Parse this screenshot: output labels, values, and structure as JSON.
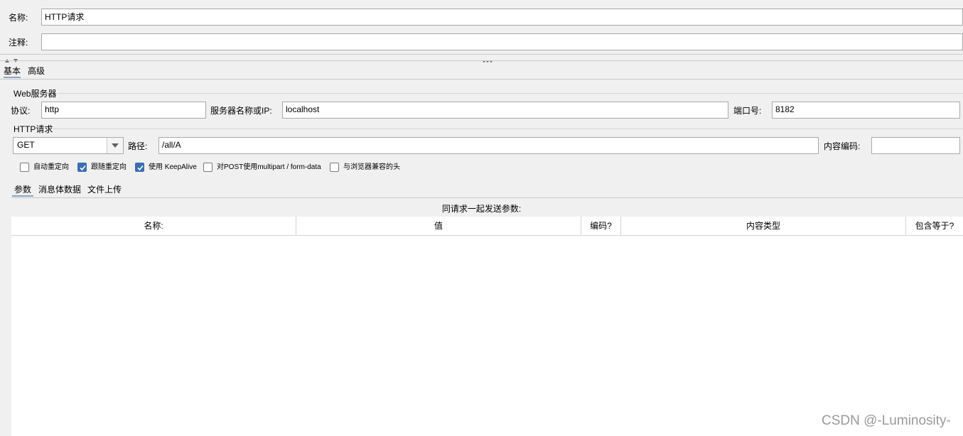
{
  "name_row": {
    "label": "名称:",
    "value": "HTTP请求"
  },
  "comment_row": {
    "label": "注释:",
    "value": ""
  },
  "tabs": [
    {
      "label": "基本",
      "active": true
    },
    {
      "label": "高级",
      "active": false
    }
  ],
  "web_server": {
    "title": "Web服务器",
    "protocol_label": "协议:",
    "protocol_value": "http",
    "server_label": "服务器名称或IP:",
    "server_value": "localhost",
    "port_label": "端口号:",
    "port_value": "8182"
  },
  "http_request": {
    "title": "HTTP请求",
    "method": "GET",
    "path_label": "路径:",
    "path_value": "/all/A",
    "encoding_label": "内容编码:",
    "encoding_value": ""
  },
  "checkboxes": [
    {
      "label": "自动重定向",
      "checked": false
    },
    {
      "label": "跟随重定向",
      "checked": true
    },
    {
      "label": "使用 KeepAlive",
      "checked": true
    },
    {
      "label": "对POST使用multipart / form-data",
      "checked": false
    },
    {
      "label": "与浏览器兼容的头",
      "checked": false
    }
  ],
  "sub_tabs": [
    {
      "label": "参数",
      "active": true
    },
    {
      "label": "消息体数据",
      "active": false
    },
    {
      "label": "文件上传",
      "active": false
    }
  ],
  "params": {
    "caption": "同请求一起发送参数:",
    "columns": [
      "名称:",
      "值",
      "编码?",
      "内容类型",
      "包含等于?"
    ]
  },
  "watermark": "CSDN @-Luminosity-",
  "colors": {
    "accent": "#3c6fae",
    "tab_underline": "#8aa6c1",
    "background": "#f0f0f0"
  }
}
